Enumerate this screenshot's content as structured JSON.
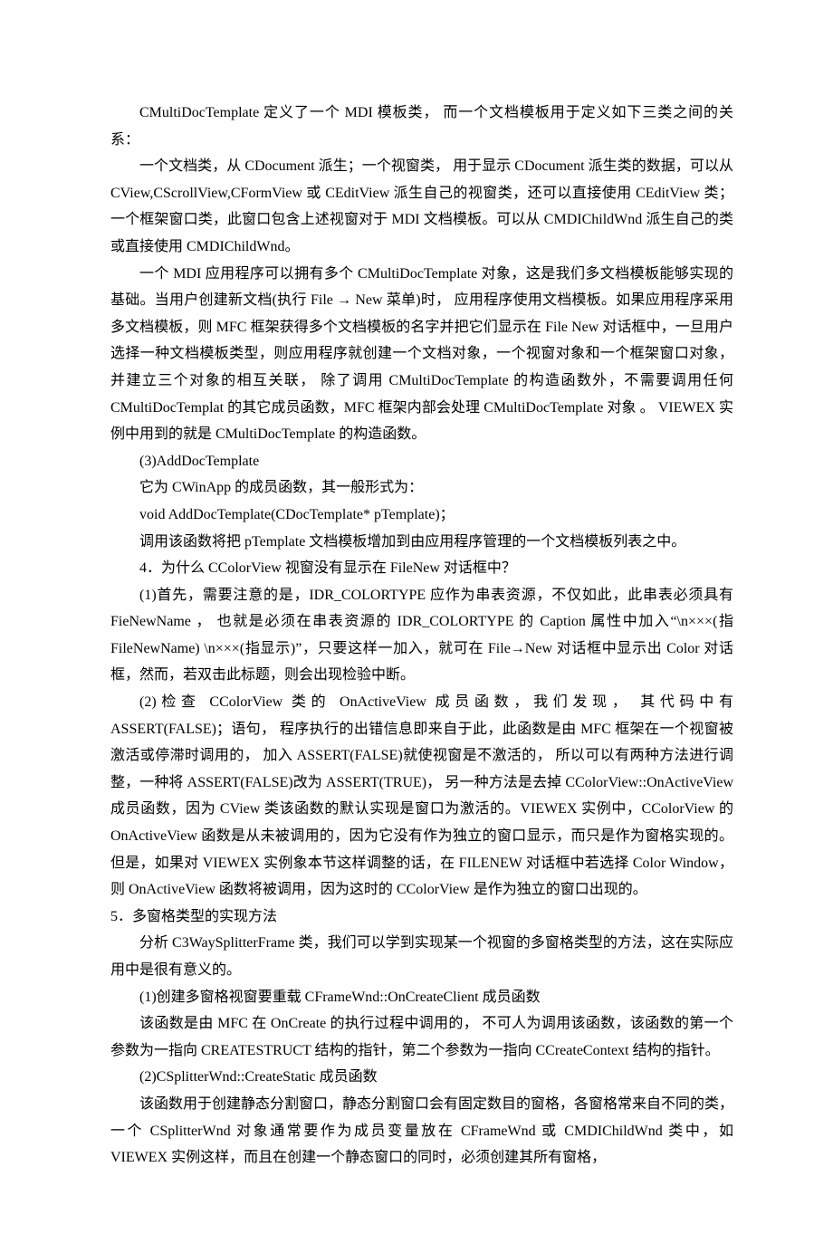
{
  "paragraphs": [
    {
      "cls": "indent",
      "text": "CMultiDocTemplate 定义了一个 MDI 模板类，  而一个文档模板用于定义如下三类之间的关系："
    },
    {
      "cls": "indent",
      "text": "一个文档类，从 CDocument 派生；一个视窗类，   用于显示 CDocument 派生类的数据，可以从 CView,CScrollView,CFormView 或 CEditView 派生自己的视窗类，还可以直接使用 CEditView 类；一个框架窗口类，此窗口包含上述视窗对于 MDI 文档模板。可以从 CMDIChildWnd 派生自己的类或直接使用 CMDIChildWnd。"
    },
    {
      "cls": "indent",
      "text": "一个 MDI 应用程序可以拥有多个 CMultiDocTemplate 对象，这是我们多文档模板能够实现的基础。当用户创建新文档(执行 File → New 菜单)时，  应用程序使用文档模板。如果应用程序采用多文档模板，则 MFC 框架获得多个文档模板的名字并把它们显示在 File New 对话框中，一旦用户选择一种文档模板类型，则应用程序就创建一个文档对象，一个视窗对象和一个框架窗口对象，  并建立三个对象的相互关联，   除了调用 CMultiDocTemplate 的构造函数外，不需要调用任何 CMultiDocTemplat 的其它成员函数，MFC  框架内部会处理  CMultiDocTemplate  对象 。 VIEWEX  实例中用到的就是 CMultiDocTemplate 的构造函数。"
    },
    {
      "cls": "indent",
      "text": "(3)AddDocTemplate"
    },
    {
      "cls": "indent",
      "text": "它为 CWinApp 的成员函数，其一般形式为："
    },
    {
      "cls": "indent",
      "text": "void AddDocTemplate(CDocTemplate* pTemplate)；"
    },
    {
      "cls": "indent",
      "text": "调用该函数将把 pTemplate 文档模板增加到由应用程序管理的一个文档模板列表之中。"
    },
    {
      "cls": "indent",
      "text": "4．为什么 CColorView 视窗没有显示在 FileNew 对话框中？"
    },
    {
      "cls": "indent",
      "text": "(1)首先，需要注意的是，IDR_COLORTYPE 应作为串表资源，不仅如此，此串表必须具有 FieNewName ，  也就是必须在串表资源的 IDR_COLORTYPE 的 Caption 属性中加入“\\n×××(指 FileNewName) \\n×××(指显示)”，只要这样一加入，就可在 File→New 对话框中显示出 Color 对话框，然而，若双击此标题，则会出现检验中断。"
    },
    {
      "cls": "indent",
      "text": " (2)检查 CColorView 类的 OnActiveView 成员函数，我们发现，  其代码中有 ASSERT(FALSE)；语句，  程序执行的出错信息即来自于此，此函数是由 MFC 框架在一个视窗被激活或停滞时调用的，  加入 ASSERT(FALSE)就使视窗是不激活的，  所以可以有两种方法进行调整，一种将 ASSERT(FALSE)改为 ASSERT(TRUE)，  另一种方法是去掉 CColorView::OnActiveView 成员函数，因为 CView 类该函数的默认实现是窗口为激活的。VIEWEX 实例中，CColorView 的 OnActiveView 函数是从未被调用的，因为它没有作为独立的窗口显示，而只是作为窗格实现的。  但是，如果对 VIEWEX 实例象本节这样调整的话，在 FILENEW 对话框中若选择 Color Window，则 OnActiveView 函数将被调用，因为这时的 CColorView 是作为独立的窗口出现的。"
    },
    {
      "cls": "no-indent",
      "text": "5．多窗格类型的实现方法"
    },
    {
      "cls": "indent",
      "text": "分析 C3WaySplitterFrame 类，我们可以学到实现某一个视窗的多窗格类型的方法，这在实际应用中是很有意义的。"
    },
    {
      "cls": "indent",
      "text": "(1)创建多窗格视窗要重载 CFrameWnd::OnCreateClient 成员函数"
    },
    {
      "cls": "indent",
      "text": "该函数是由 MFC 在 OnCreate 的执行过程中调用的，  不可人为调用该函数，该函数的第一个参数为一指向  CREATESTRUCT  结构的指针，第二个参数为一指向 CCreateContext 结构的指针。"
    },
    {
      "cls": "indent",
      "text": "(2)CSplitterWnd::CreateStatic 成员函数"
    },
    {
      "cls": "indent",
      "text": "该函数用于创建静态分割窗口，静态分割窗口会有固定数目的窗格，各窗格常来自不同的类，一个 CSplitterWnd 对象通常要作为成员变量放在 CFrameWnd 或 CMDIChildWnd 类中，如 VIEWEX 实例这样，而且在创建一个静态窗口的同时，必须创建其所有窗格，"
    }
  ]
}
